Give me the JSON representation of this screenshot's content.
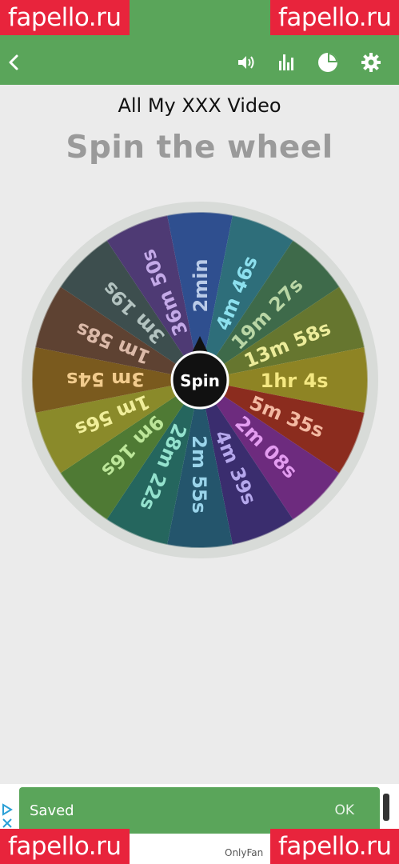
{
  "watermarks": {
    "left": "fapello.ru",
    "right": "fapello.ru",
    "bottom_left": "fapello.ru",
    "bottom_right": "fapello.ru"
  },
  "toolbar": {
    "back_icon": "chevron-left-icon",
    "sound_icon": "volume-icon",
    "stats_icon": "bar-chart-icon",
    "pie_icon": "pie-chart-icon",
    "settings_icon": "gear-icon"
  },
  "wheel_subtitle": "All My XXX Video",
  "title": "Spin the wheel",
  "spin_label": "Spin",
  "segments": [
    {
      "label": "2min",
      "color": "#2f4f8f"
    },
    {
      "label": "4m 46s",
      "color": "#2e6e7a"
    },
    {
      "label": "19m 27s",
      "color": "#3e6a4a"
    },
    {
      "label": "13m 58s",
      "color": "#66762f"
    },
    {
      "label": "1hr 4s",
      "color": "#8e8424"
    },
    {
      "label": "5m 35s",
      "color": "#8b2c1e"
    },
    {
      "label": "2m 08s",
      "color": "#6d2b7e"
    },
    {
      "label": "4m 39s",
      "color": "#3a2d6e"
    },
    {
      "label": "2m 55s",
      "color": "#24556c"
    },
    {
      "label": "28m 22s",
      "color": "#25665e"
    },
    {
      "label": "9m 16s",
      "color": "#4f7a34"
    },
    {
      "label": "1m 56s",
      "color": "#8a8a2a"
    },
    {
      "label": "3m 54s",
      "color": "#7a5a1e"
    },
    {
      "label": "1m 58s",
      "color": "#5e4232"
    },
    {
      "label": "3m 19s",
      "color": "#3d4e4e"
    },
    {
      "label": "36m 50s",
      "color": "#4e3a74"
    }
  ],
  "label_colors": [
    "#b9cbe8",
    "#8ce0ee",
    "#b9d6a5",
    "#ecec9a",
    "#f4e882",
    "#f3b9a2",
    "#e39cf0",
    "#b5a8ec",
    "#9ad4ea",
    "#94e2ce",
    "#bce699",
    "#f0ee99",
    "#f1cb8d",
    "#dbb9a8",
    "#b3c3c0",
    "#c4aae8"
  ],
  "snackbar": {
    "message": "Saved",
    "action": "OK"
  },
  "footer_text": "OnlyFan"
}
